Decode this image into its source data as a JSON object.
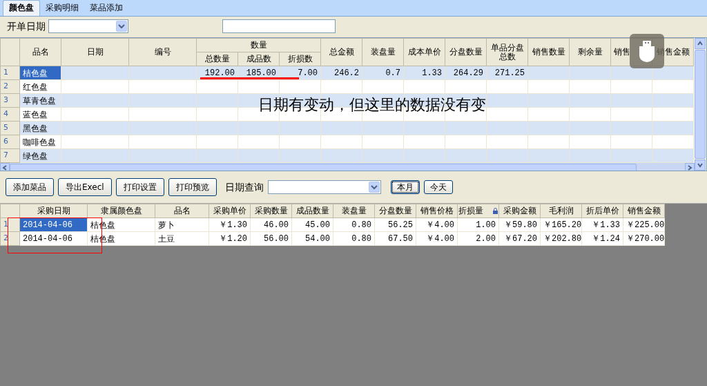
{
  "tabs": [
    {
      "label": "颜色盘",
      "selected": true
    },
    {
      "label": "采购明细",
      "selected": false
    },
    {
      "label": "菜品添加",
      "selected": false
    }
  ],
  "filter": {
    "label": "开单日期"
  },
  "top_grid": {
    "columns": [
      {
        "label": "品名"
      },
      {
        "label": "日期"
      },
      {
        "label": "编号"
      },
      {
        "label": "数量",
        "children": [
          {
            "label": "总数量"
          },
          {
            "label": "成品数"
          },
          {
            "label": "折损数"
          }
        ]
      },
      {
        "label": "总金额"
      },
      {
        "label": "装盘量"
      },
      {
        "label": "成本单价"
      },
      {
        "label": "分盘数量"
      },
      {
        "label": "单品分盘总数"
      },
      {
        "label": "销售数量"
      },
      {
        "label": "剩余量"
      },
      {
        "label": "销售"
      },
      {
        "label": "销售金额"
      }
    ],
    "rows": [
      {
        "number": "1",
        "name": "桔色盘",
        "selected": true,
        "values": [
          "192.00",
          "185.00",
          "7.00",
          "246.2",
          "0.7",
          "1.33",
          "264.29",
          "271.25"
        ]
      },
      {
        "number": "2",
        "name": "红色盘",
        "selected": false
      },
      {
        "number": "3",
        "name": "草青色盘",
        "selected": false
      },
      {
        "number": "4",
        "name": "蓝色盘",
        "selected": false
      },
      {
        "number": "5",
        "name": "黑色盘",
        "selected": false
      },
      {
        "number": "6",
        "name": "咖啡色盘",
        "selected": false
      },
      {
        "number": "7",
        "name": "绿色盘",
        "selected": false
      }
    ]
  },
  "annotation": "日期有变动，但这里的数据没有变",
  "actions": [
    {
      "label": "添加菜品"
    },
    {
      "label": "导出Execl"
    },
    {
      "label": "打印设置"
    },
    {
      "label": "打印预览"
    }
  ],
  "date_query": {
    "label": "日期查询"
  },
  "quick_buttons": [
    {
      "label": "本月",
      "focused": true
    },
    {
      "label": "今天",
      "focused": false
    }
  ],
  "bottom_grid": {
    "columns": [
      {
        "label": "采购日期"
      },
      {
        "label": "隶属颜色盘"
      },
      {
        "label": "品名"
      },
      {
        "label": "采购单价"
      },
      {
        "label": "采购数量"
      },
      {
        "label": "成品数量"
      },
      {
        "label": "装盘量"
      },
      {
        "label": "分盘数量"
      },
      {
        "label": "销售价格"
      },
      {
        "label": "折损量",
        "locked": true
      },
      {
        "label": "采购金额"
      },
      {
        "label": "毛利润"
      },
      {
        "label": "折后单价"
      },
      {
        "label": "销售金额"
      }
    ],
    "rows": [
      {
        "number": "1",
        "selected": true,
        "cells": [
          "2014-04-06",
          "桔色盘",
          "萝卜",
          "￥1.30",
          "46.00",
          "45.00",
          "0.80",
          "56.25",
          "￥4.00",
          "1.00",
          "￥59.80",
          "￥165.20",
          "￥1.33",
          "￥225.00"
        ]
      },
      {
        "number": "2",
        "selected": false,
        "cells": [
          "2014-04-06",
          "桔色盘",
          "土豆",
          "￥1.20",
          "56.00",
          "54.00",
          "0.80",
          "67.50",
          "￥4.00",
          "2.00",
          "￥67.20",
          "￥202.80",
          "￥1.24",
          "￥270.00"
        ]
      }
    ]
  }
}
